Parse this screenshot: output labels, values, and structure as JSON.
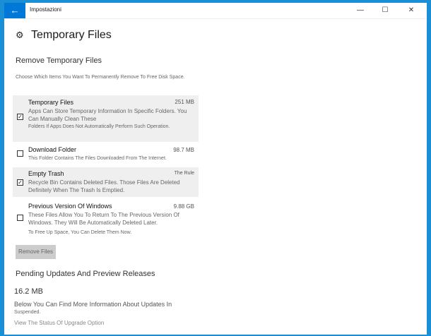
{
  "window": {
    "app_title": "Impostazioni",
    "back_icon": "←",
    "minimize_icon": "—",
    "maximize_icon": "☐",
    "close_icon": "✕"
  },
  "header": {
    "gear_icon": "⚙",
    "title": "Temporary Files"
  },
  "section": {
    "title": "Remove Temporary Files",
    "instruction": "Choose Which Items You Want To Permanently Remove To Free Disk Space."
  },
  "items": [
    {
      "name": "Temporary Files",
      "size": "251 MB",
      "checked": true,
      "desc": "Apps Can Store Temporary Information In Specific Folders. You Can Manually Clean These",
      "desc2": "Folders If Apps Does Not Automatically Perform Such Operation."
    },
    {
      "name": "Download Folder",
      "size": "98.7 MB",
      "checked": false,
      "desc": "This Folder Contains The Files Downloaded From The Internet."
    },
    {
      "name": "Empty Trash",
      "size": "The Rule",
      "checked": true,
      "desc": "Recycle Bin Contains Deleted Files. Those Files Are Deleted Definitely When The Trash Is Emptied."
    },
    {
      "name": "Previous Version Of Windows",
      "size": "9.88 GB",
      "checked": false,
      "desc": "These Files Allow You To Return To The Previous Version Of Windows. They Will Be Automatically Deleted Later.",
      "desc2": "To Free Up Space, You Can Delete Them Now."
    }
  ],
  "remove_button": "Remove Files",
  "pending": {
    "title": "Pending Updates And Preview Releases",
    "size": "16.2 MB",
    "text": "Below You Can Find More Information About Updates In",
    "sub": "Suspended.",
    "link": "View The Status Of Upgrade Option"
  }
}
